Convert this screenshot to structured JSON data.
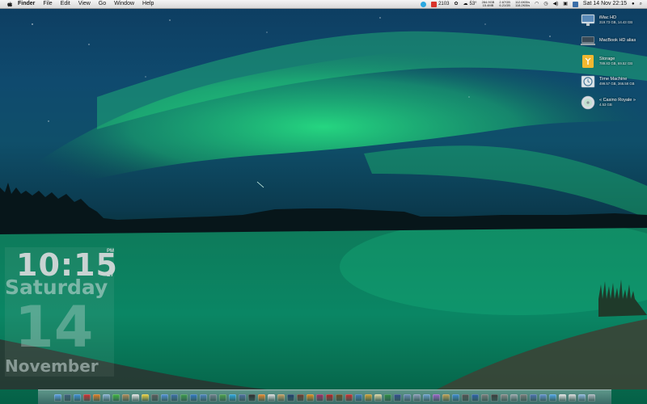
{
  "menubar": {
    "app_name": "Finder",
    "menus": [
      "File",
      "Edit",
      "View",
      "Go",
      "Window",
      "Help"
    ],
    "status": {
      "mail_count": "2103",
      "temperature": "53°",
      "memory_top": "284.9GB",
      "memory_bottom": "15.4MB",
      "disk_top": "2.67GB",
      "disk_bottom": "6.21GB",
      "net_top": "112.6KB/s",
      "net_bottom": "118.2KB/s",
      "date_time": "Sat 14 Nov  22:15"
    }
  },
  "drives": [
    {
      "name": "iMac HD",
      "size": "319.73 GB, 14.43 GB",
      "icon": "imac-hd-icon",
      "color": "#9fb7c8"
    },
    {
      "name": "MacBook HD alias",
      "size": "",
      "icon": "macbook-hd-icon",
      "color": "#6f7f8a"
    },
    {
      "name": "Storage",
      "size": "789.83 GB, 69.52 GB",
      "icon": "storage-drive-icon",
      "color": "#f2b830"
    },
    {
      "name": "Time Machine",
      "size": "499.57 GB, 366.58 GB",
      "icon": "time-machine-icon",
      "color": "#8aa0ae"
    },
    {
      "name": "« Casino Royale »",
      "size": "4.53 GB",
      "icon": "dvd-disc-icon",
      "color": "#d8dde2"
    }
  ],
  "clock_widget": {
    "time": "10:15",
    "ampm": "PM",
    "seconds": "27",
    "day": "Saturday",
    "date": "14",
    "month": "November"
  },
  "dock": {
    "apps": [
      {
        "name": "finder",
        "color": "#5aa0e8"
      },
      {
        "name": "dashboard",
        "color": "#3b5d7a"
      },
      {
        "name": "safari",
        "color": "#3c8fd8"
      },
      {
        "name": "opera",
        "color": "#d02a2a"
      },
      {
        "name": "firefox",
        "color": "#e07a1f"
      },
      {
        "name": "mail",
        "color": "#8ab4d8"
      },
      {
        "name": "ichat",
        "color": "#3cb33c"
      },
      {
        "name": "address-book",
        "color": "#b28a55"
      },
      {
        "name": "ical",
        "color": "#e8e8e8"
      },
      {
        "name": "stickies",
        "color": "#f0d23a"
      },
      {
        "name": "photo-booth",
        "color": "#5a5a5a"
      },
      {
        "name": "itunes",
        "color": "#4d8fd8"
      },
      {
        "name": "quicktime",
        "color": "#3a6ea8"
      },
      {
        "name": "time-machine",
        "color": "#3b9a4a"
      },
      {
        "name": "network",
        "color": "#2f78c4"
      },
      {
        "name": "spotlight",
        "color": "#4b84c0"
      },
      {
        "name": "system-prefs",
        "color": "#6f7f8c"
      },
      {
        "name": "activity",
        "color": "#4aa04a"
      },
      {
        "name": "skype",
        "color": "#2aa7e0"
      },
      {
        "name": "grapher",
        "color": "#4c6e9e"
      },
      {
        "name": "terminal",
        "color": "#2a2a2a"
      },
      {
        "name": "vlc",
        "color": "#e8892a"
      },
      {
        "name": "textedit",
        "color": "#e0e0e0"
      },
      {
        "name": "preview",
        "color": "#c8a060"
      },
      {
        "name": "photoshop",
        "color": "#1c3d6a"
      },
      {
        "name": "fireworks",
        "color": "#6b3a2a"
      },
      {
        "name": "illustrator",
        "color": "#e08a1a"
      },
      {
        "name": "indesign",
        "color": "#a02860"
      },
      {
        "name": "acrobat",
        "color": "#b42020"
      },
      {
        "name": "bridge",
        "color": "#6a4a20"
      },
      {
        "name": "transmission",
        "color": "#c82a2a"
      },
      {
        "name": "coda",
        "color": "#3a7ab8"
      },
      {
        "name": "cyberduck",
        "color": "#d0a030"
      },
      {
        "name": "pages",
        "color": "#e0d6a0"
      },
      {
        "name": "numbers",
        "color": "#2a8a40"
      },
      {
        "name": "keynote",
        "color": "#2e4a8c"
      },
      {
        "name": "xcode",
        "color": "#6a8ab8"
      },
      {
        "name": "interface-builder",
        "color": "#8a9ab8"
      },
      {
        "name": "iphoto",
        "color": "#6aa0d0"
      },
      {
        "name": "imovie",
        "color": "#9a60c8"
      },
      {
        "name": "garageband",
        "color": "#c0a050"
      },
      {
        "name": "iweb",
        "color": "#3a8ad0"
      },
      {
        "name": "idvd",
        "color": "#505050"
      },
      {
        "name": "dictionary",
        "color": "#2a5fa8"
      },
      {
        "name": "calculator",
        "color": "#7a7a7a"
      },
      {
        "name": "chess",
        "color": "#3a3a3a"
      },
      {
        "name": "font-book",
        "color": "#8a8a8a"
      },
      {
        "name": "disk-utility",
        "color": "#9aa4aa"
      },
      {
        "name": "console",
        "color": "#7a7a7a"
      },
      {
        "name": "expose",
        "color": "#4a70b0"
      },
      {
        "name": "spaces",
        "color": "#6090d0"
      },
      {
        "name": "app-store",
        "color": "#4ea4e8"
      },
      {
        "name": "downloads",
        "color": "#e8e8e8"
      },
      {
        "name": "documents",
        "color": "#dcdcdc"
      },
      {
        "name": "applications",
        "color": "#8fb8e0"
      },
      {
        "name": "trash",
        "color": "#b0b8c0"
      }
    ]
  }
}
